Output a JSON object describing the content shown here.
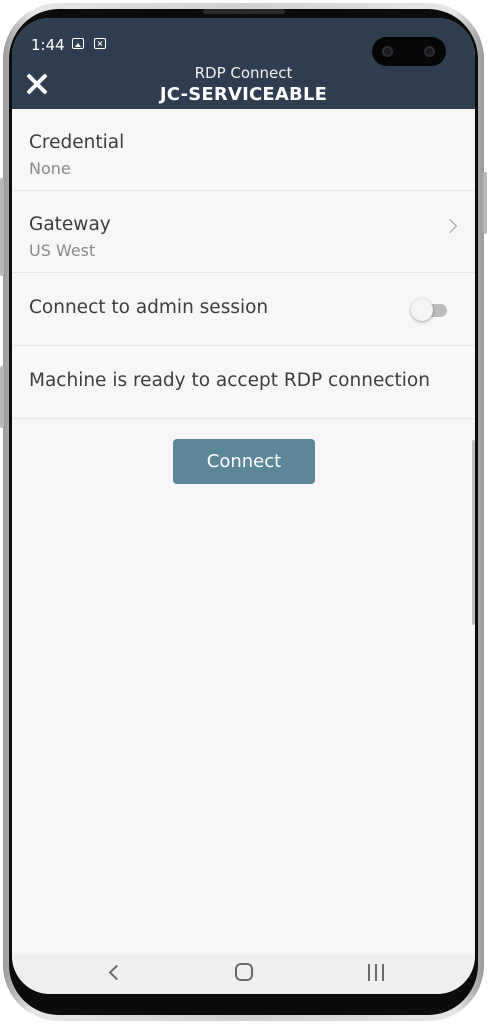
{
  "status_bar": {
    "time": "1:44",
    "icons": [
      "image-icon",
      "close-box-icon"
    ]
  },
  "header": {
    "subtitle": "RDP Connect",
    "title": "JC-SERVICEABLE",
    "background_color": "#2e3e50"
  },
  "settings": {
    "credential": {
      "label": "Credential",
      "value": "None"
    },
    "gateway": {
      "label": "Gateway",
      "value": "US West"
    },
    "admin_session": {
      "label": "Connect to admin session",
      "enabled": false
    },
    "status_message": "Machine is ready to accept RDP connection"
  },
  "actions": {
    "connect_label": "Connect",
    "connect_color": "#5b8799"
  },
  "nav_bar": {
    "buttons": [
      "back-icon",
      "home-icon",
      "recent-apps-icon"
    ]
  }
}
